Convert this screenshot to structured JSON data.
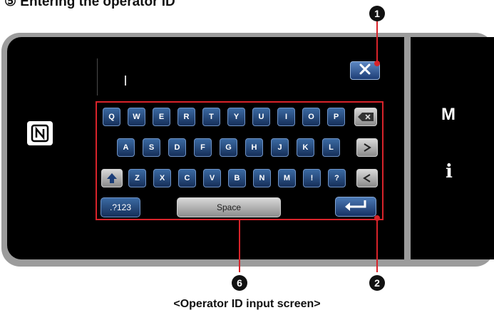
{
  "heading": "⑤ Entering the operator ID",
  "caption": "<Operator ID input screen>",
  "input": {
    "value": "|"
  },
  "keyboard": {
    "row1": [
      "Q",
      "W",
      "E",
      "R",
      "T",
      "Y",
      "U",
      "I",
      "O",
      "P"
    ],
    "row2": [
      "A",
      "S",
      "D",
      "F",
      "G",
      "H",
      "J",
      "K",
      "L"
    ],
    "row3": [
      "Z",
      "X",
      "C",
      "V",
      "B",
      "N",
      "M",
      "!",
      "?"
    ],
    "mode_label": ".?123",
    "space_label": "Space"
  },
  "side_panel": {
    "menu_label": "M",
    "info_label": "i"
  },
  "callouts": {
    "close": "1",
    "enter": "2",
    "keyboard": "6"
  },
  "icons": [
    "nfc-icon",
    "close-icon",
    "backspace-icon",
    "cursor-right-icon",
    "cursor-left-icon",
    "shift-icon",
    "enter-icon"
  ],
  "colors": {
    "accent_red": "#d8232a",
    "key_blue": "#1f4a83",
    "screen_bg": "#000000"
  }
}
